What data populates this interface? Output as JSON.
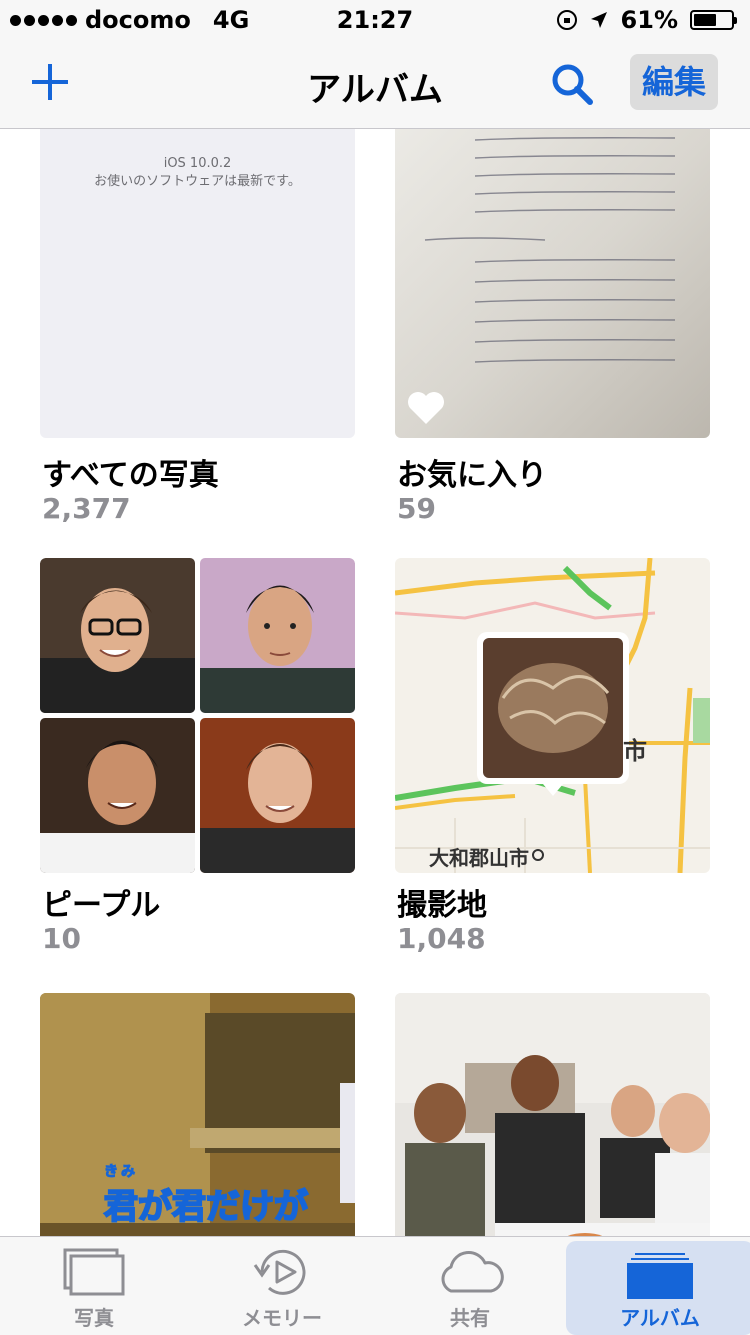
{
  "status_bar": {
    "carrier": "docomo",
    "network": "4G",
    "time": "21:27",
    "battery": "61%",
    "battery_level": 0.61
  },
  "nav": {
    "title": "アルバム",
    "edit_label": "編集"
  },
  "albums": [
    {
      "title": "すべての写真",
      "count": "2,377",
      "thumb_text_line1": "iOS 10.0.2",
      "thumb_text_line2": "お使いのソフトウェアは最新です。"
    },
    {
      "title": "お気に入り",
      "count": "59"
    },
    {
      "title": "ピープル",
      "count": "10"
    },
    {
      "title": "撮影地",
      "count": "1,048",
      "map_label_city": "大和郡山市",
      "map_label_partial": "市"
    },
    {
      "title": "",
      "count": "",
      "caption_ruby": "きみ",
      "caption_text": "君が君だけが"
    },
    {
      "title": "",
      "count": ""
    }
  ],
  "tabs": [
    {
      "label": "写真",
      "icon": "photos-icon",
      "active": false
    },
    {
      "label": "メモリー",
      "icon": "memories-icon",
      "active": false
    },
    {
      "label": "共有",
      "icon": "cloud-icon",
      "active": false
    },
    {
      "label": "アルバム",
      "icon": "albums-icon",
      "active": true
    }
  ],
  "colors": {
    "accent": "#1565d8",
    "secondary_text": "#8e8e93",
    "bar_background": "#f7f7f7"
  }
}
